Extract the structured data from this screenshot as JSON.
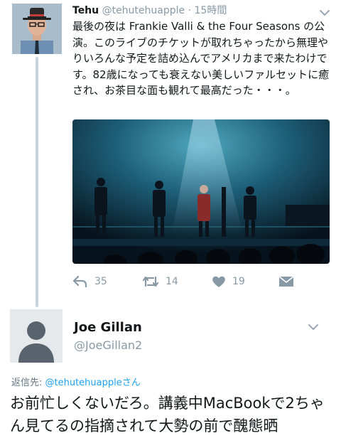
{
  "tweet1": {
    "author_name": "Tehu",
    "handle": "@tehutehuapple",
    "separator": "·",
    "time": "15時間",
    "text": "最後の夜は Frankie Valli & the Four Seasons の公演。このライブのチケットが取れちゃったから無理やりいろんな予定を詰め込んでアメリカまで来たわけです。82歳になっても衰えない美しいファルセットに癒され、お茶目な面も観れて最高だった・・・。",
    "actions": {
      "reply_count": "35",
      "retweet_count": "14",
      "like_count": "19"
    }
  },
  "tweet2": {
    "author_name": "Joe Gillan",
    "handle": "@JoeGillan2",
    "replying_prefix": "返信先: ",
    "replying_handle": "@tehutehuapple",
    "replying_suffix": "さん",
    "text": "お前忙しくないだろ。講義中MacBookで2ちゃん見てるの指摘されて大勢の前で醜態晒"
  },
  "colors": {
    "muted": "#8899a6",
    "link": "#1da1f2",
    "thread_line": "#c7d4de",
    "text": "#14171a"
  },
  "icons": [
    "chevron-down-icon",
    "reply-icon",
    "retweet-icon",
    "like-icon",
    "direct-message-icon",
    "default-avatar-icon"
  ]
}
